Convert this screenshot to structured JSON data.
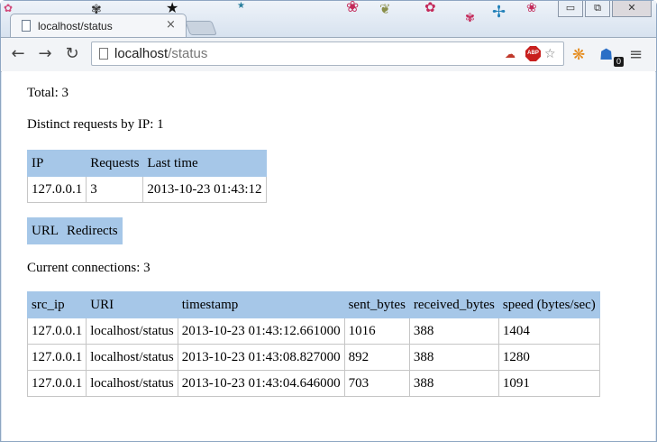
{
  "browser": {
    "tab_title": "localhost/status",
    "tab_close": "×",
    "url_host": "localhost",
    "url_path": "/status",
    "window_buttons": [
      "▭",
      "⧉",
      "✕"
    ],
    "abp_label": "ABP",
    "ext_badge": "0"
  },
  "page": {
    "total_text": "Total: 3",
    "distinct_text": "Distinct requests by IP: 1",
    "ip_table": {
      "headers": [
        "IP",
        "Requests",
        "Last time"
      ],
      "rows": [
        [
          "127.0.0.1",
          "3",
          "2013-10-23 01:43:12"
        ]
      ]
    },
    "redirect_table": {
      "headers": [
        "URL",
        "Redirects"
      ]
    },
    "current_text": "Current connections: 3",
    "conn_table": {
      "headers": [
        "src_ip",
        "URI",
        "timestamp",
        "sent_bytes",
        "received_bytes",
        "speed (bytes/sec)"
      ],
      "rows": [
        [
          "127.0.0.1",
          "localhost/status",
          "2013-10-23 01:43:12.661000",
          "1016",
          "388",
          "1404"
        ],
        [
          "127.0.0.1",
          "localhost/status",
          "2013-10-23 01:43:08.827000",
          "892",
          "388",
          "1280"
        ],
        [
          "127.0.0.1",
          "localhost/status",
          "2013-10-23 01:43:04.646000",
          "703",
          "388",
          "1091"
        ]
      ]
    }
  }
}
